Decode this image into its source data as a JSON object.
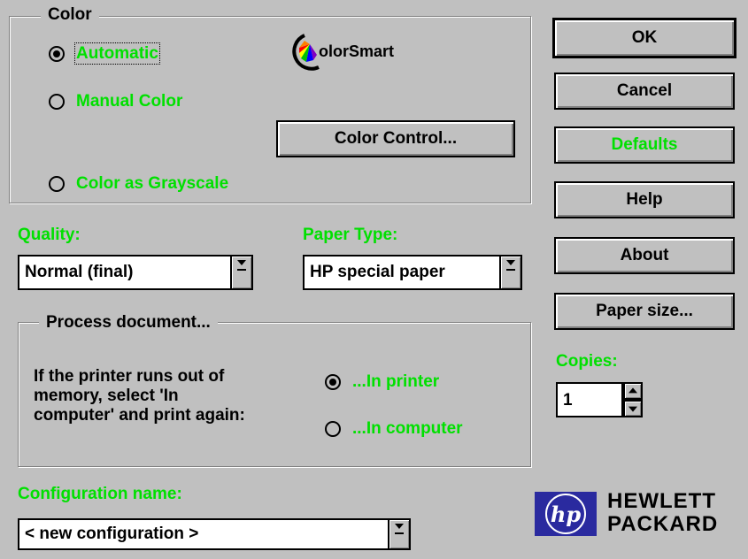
{
  "color_group": {
    "title": "Color",
    "automatic_label": "Automatic",
    "manual_label": "Manual Color",
    "grayscale_label": "Color as Grayscale",
    "logo_text": "olorSmart",
    "color_control_button": "Color Control..."
  },
  "quality": {
    "label": "Quality:",
    "value": "Normal (final)"
  },
  "paper_type": {
    "label": "Paper Type:",
    "value": "HP special paper"
  },
  "process_group": {
    "title": "Process document...",
    "description_line1": "If the printer runs out of",
    "description_line2": "memory, select 'In",
    "description_line3": "computer' and print again:",
    "in_printer_label": "...In printer",
    "in_computer_label": "...In computer"
  },
  "configuration": {
    "label": "Configuration name:",
    "value": "< new configuration >"
  },
  "buttons": {
    "ok": "OK",
    "cancel": "Cancel",
    "defaults": "Defaults",
    "help": "Help",
    "about": "About",
    "paper_size": "Paper size..."
  },
  "copies": {
    "label": "Copies:",
    "value": "1"
  },
  "brand": {
    "logo": "hp",
    "line1": "HEWLETT",
    "line2": "PACKARD"
  },
  "colors": {
    "dialog_bg": "#c0c0c0",
    "label_green": "#00e000",
    "hp_blue": "#2a2a9f"
  }
}
